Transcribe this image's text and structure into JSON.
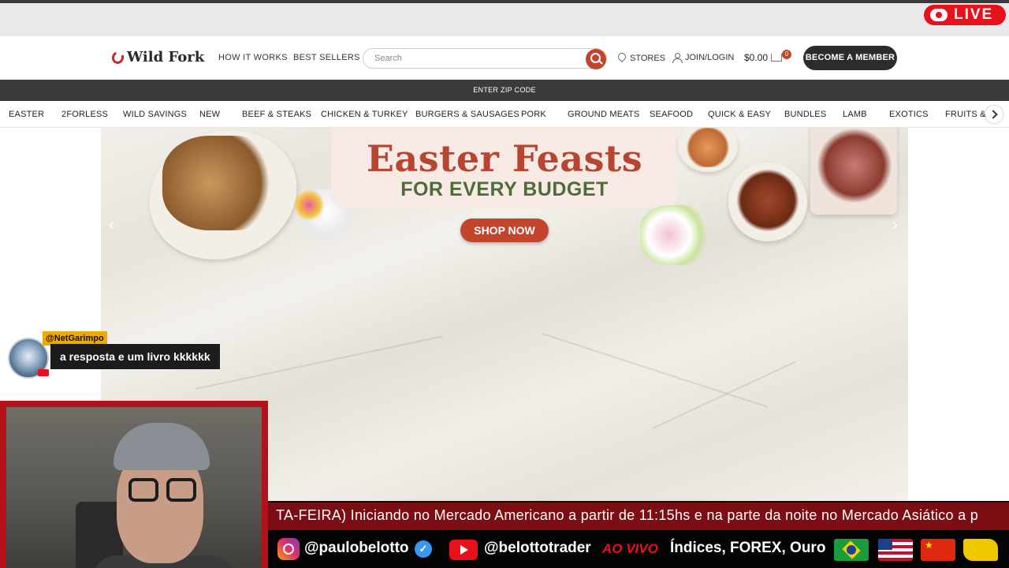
{
  "live_badge": {
    "label": "LIVE",
    "color": "#e8101a"
  },
  "header": {
    "logo": "Wild Fork",
    "nav": [
      "HOW IT WORKS",
      "BEST SELLERS"
    ],
    "search_placeholder": "Search",
    "stores": "STORES",
    "login": "JOIN/LOGIN",
    "cart_total": "$0.00",
    "cart_count": "0",
    "member_button": "BECOME A MEMBER",
    "accent_color": "#c2452c"
  },
  "zip_bar": {
    "label": "ENTER ZIP CODE"
  },
  "categories": [
    "EASTER",
    "2FORLESS",
    "WILD SAVINGS",
    "NEW",
    "BEEF & STEAKS",
    "CHICKEN & TURKEY",
    "BURGERS & SAUSAGES",
    "PORK",
    "GROUND MEATS",
    "SEAFOOD",
    "QUICK & EASY",
    "BUNDLES",
    "LAMB",
    "EXOTICS",
    "FRUITS & V"
  ],
  "hero": {
    "title": "Easter Feasts",
    "subtitle": "FOR EVERY BUDGET",
    "cta": "SHOP NOW",
    "prev": "‹",
    "next": "›"
  },
  "chat": {
    "user": "@NetGarimpo",
    "message": "a resposta e um livro kkkkkk"
  },
  "ticker": {
    "text": "TA-FEIRA) Iniciando no Mercado Americano a partir de 11:15hs e na parte da noite no Mercado Asiático a p"
  },
  "social": {
    "instagram": "@paulobelotto",
    "youtube": "@belottotrader",
    "live_label": "AO VIVO",
    "topics": "Índices, FOREX, Ouro",
    "flags": [
      "brazil-flag",
      "usa-flag",
      "china-flag",
      "yellow-flag"
    ]
  }
}
